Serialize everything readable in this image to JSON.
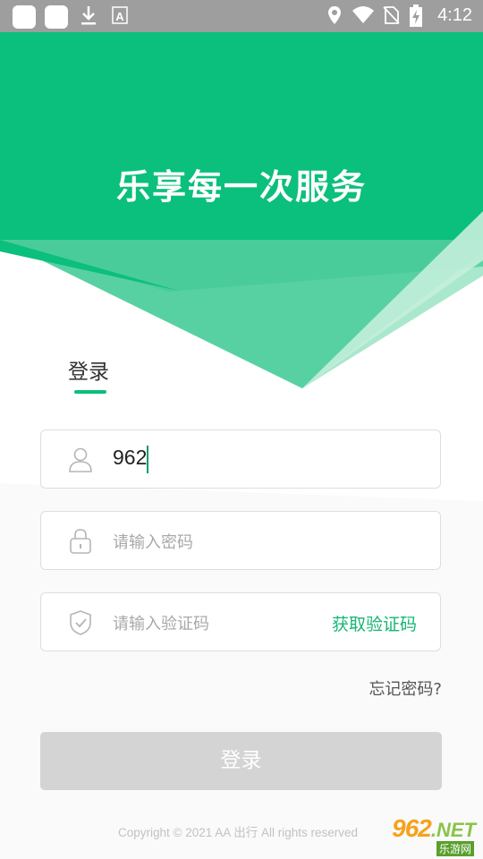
{
  "status_bar": {
    "time": "4:12",
    "icons": [
      "app-square-icon",
      "app-square-icon",
      "download-icon",
      "font-a-icon",
      "location-icon",
      "wifi-icon",
      "no-sim-icon",
      "battery-charging-icon"
    ]
  },
  "hero": {
    "slogan": "乐享每一次服务",
    "colors": {
      "primary": "#0bbf7c",
      "light": "#8fe0bc"
    }
  },
  "login_tab": {
    "label": "登录"
  },
  "form": {
    "phone": {
      "value": "962",
      "icon": "user-icon"
    },
    "password": {
      "placeholder": "请输入密码",
      "icon": "lock-icon"
    },
    "code": {
      "placeholder": "请输入验证码",
      "icon": "shield-icon",
      "get_code_label": "获取验证码"
    }
  },
  "forgot_label": "忘记密码?",
  "login_button": {
    "label": "登录",
    "state": "disabled"
  },
  "footer": {
    "copyright": "Copyright © 2021 AA 出行 All rights reserved"
  },
  "watermark": {
    "main": "962",
    "suffix": ".NET",
    "sub": "乐游网"
  }
}
